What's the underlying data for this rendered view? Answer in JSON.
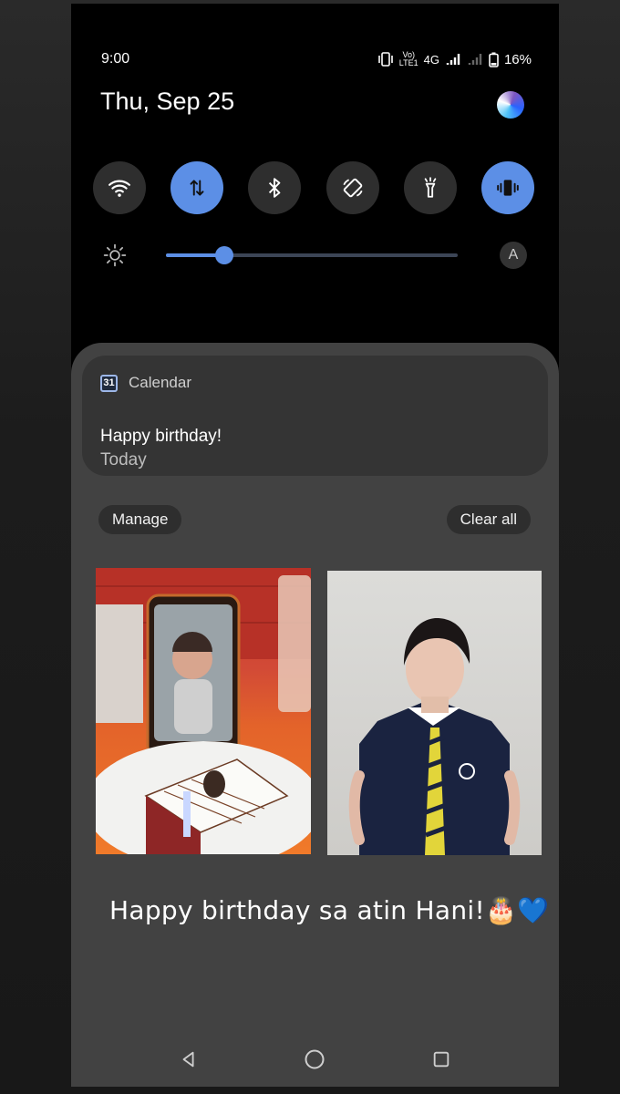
{
  "status_bar": {
    "time": "9:00",
    "network_top": "Vo)",
    "network_bottom": "LTE1",
    "network_type": "4G",
    "battery": "16%"
  },
  "header": {
    "date": "Thu, Sep 25"
  },
  "quick_settings": {
    "tiles": [
      {
        "name": "wifi",
        "active": false
      },
      {
        "name": "mobile-data",
        "active": true
      },
      {
        "name": "bluetooth",
        "active": false
      },
      {
        "name": "auto-rotate",
        "active": false
      },
      {
        "name": "flashlight",
        "active": false
      },
      {
        "name": "vibrate",
        "active": true
      }
    ],
    "brightness_level": 0.2,
    "auto_brightness_label": "A"
  },
  "notification": {
    "app_name": "Calendar",
    "app_icon_text": "31",
    "title": "Happy birthday!",
    "subtitle": "Today"
  },
  "actions": {
    "manage_label": "Manage",
    "clear_all_label": "Clear all"
  },
  "caption": {
    "text": "Happy birthday sa atin Hani!🎂💙"
  },
  "colors": {
    "accent": "#5c8fe6",
    "shade": "#424242",
    "card": "#343434"
  }
}
